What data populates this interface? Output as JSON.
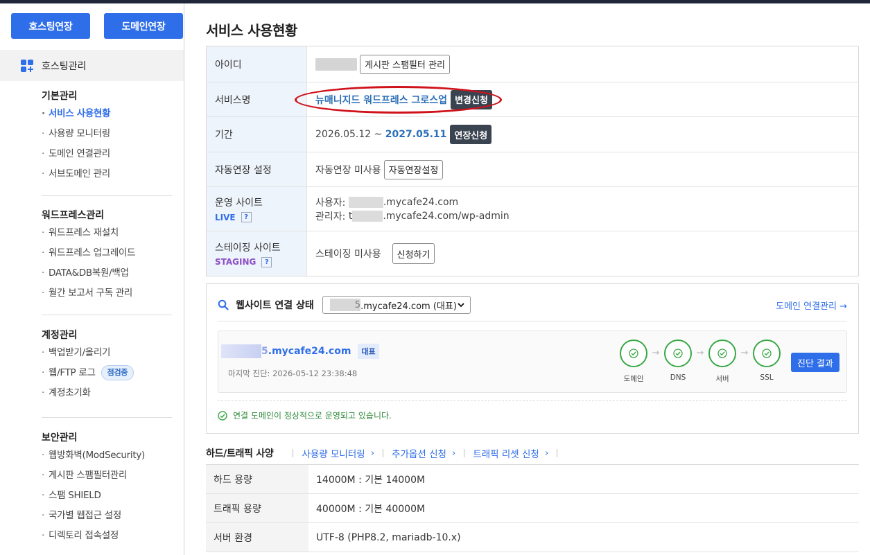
{
  "sidebar": {
    "top_buttons": [
      "호스팅연장",
      "도메인연장"
    ],
    "main_menu": "호스팅관리",
    "sections": [
      {
        "title": "기본관리",
        "items": [
          "서비스 사용현황",
          "사용량 모니터링",
          "도메인 연결관리",
          "서브도메인 관리"
        ],
        "active": 0
      },
      {
        "title": "워드프레스관리",
        "items": [
          "워드프레스 재설치",
          "워드프레스 업그레이드",
          "DATA&DB복원/백업",
          "월간 보고서 구독 관리"
        ]
      },
      {
        "title": "계정관리",
        "items": [
          "백업받기/올리기",
          "웹/FTP 로그",
          "계정초기화"
        ],
        "badge": "점검중"
      },
      {
        "title": "보안관리",
        "items": [
          "웹방화벽(ModSecurity)",
          "게시판 스팸필터관리",
          "스팸 SHIELD",
          "국가별 웹접근 설정",
          "디렉토리 접속설정"
        ]
      }
    ]
  },
  "page": {
    "title": "서비스 사용현황"
  },
  "info": {
    "id": {
      "label": "아이디",
      "button": "게시판 스팸필터 관리"
    },
    "service": {
      "label": "서비스명",
      "value": "뉴매니지드 워드프레스 그로스업",
      "button": "변경신청"
    },
    "period": {
      "label": "기간",
      "start": "2026.05.12 ~ ",
      "end": "2027.05.11",
      "button": "연장신청"
    },
    "auto": {
      "label": "자동연장 설정",
      "value": "자동연장 미사용",
      "button": "자동연장설정"
    },
    "live": {
      "label": "운영 사이트",
      "tag": "LIVE",
      "help": "?",
      "user_prefix": "사용자: ",
      "user_suffix": ".mycafe24.com",
      "admin_prefix": "관리자: ",
      "admin_partial": "t",
      "admin_suffix": ".mycafe24.com/wp-admin"
    },
    "staging": {
      "label": "스테이징 사이트",
      "tag": "STAGING",
      "help": "?",
      "value": "스테이징 미사용",
      "button": "신청하기"
    }
  },
  "connection": {
    "title": "웹사이트 연결 상태",
    "select_prefix": "5",
    "select_value": ".mycafe24.com (대표)",
    "link": "도메인 연결관리 →",
    "card_prefix": "5",
    "card_domain": ".mycafe24.com",
    "card_badge": "대표",
    "last_diag": "마지막 진단: 2026-05-12 23:38:48",
    "steps": [
      "도메인",
      "DNS",
      "서버",
      "SSL"
    ],
    "diag_button": "진단 결과",
    "status_ok": "연결 도메인이 정상적으로 운영되고 있습니다.",
    "colors": {
      "ok": "#39a845",
      "primary": "#2f6ee9"
    }
  },
  "spec": {
    "title": "하드/트래픽 사양",
    "links": [
      "사용량 모니터링",
      "추가옵션 신청",
      "트래픽 리셋 신청"
    ],
    "rows": [
      {
        "label": "하드 용량",
        "value": "14000M : 기본 14000M"
      },
      {
        "label": "트래픽 용량",
        "value": "40000M : 기본 40000M"
      },
      {
        "label": "서버 환경",
        "value": "UTF-8 (PHP8.2, mariadb-10.x)"
      }
    ]
  }
}
